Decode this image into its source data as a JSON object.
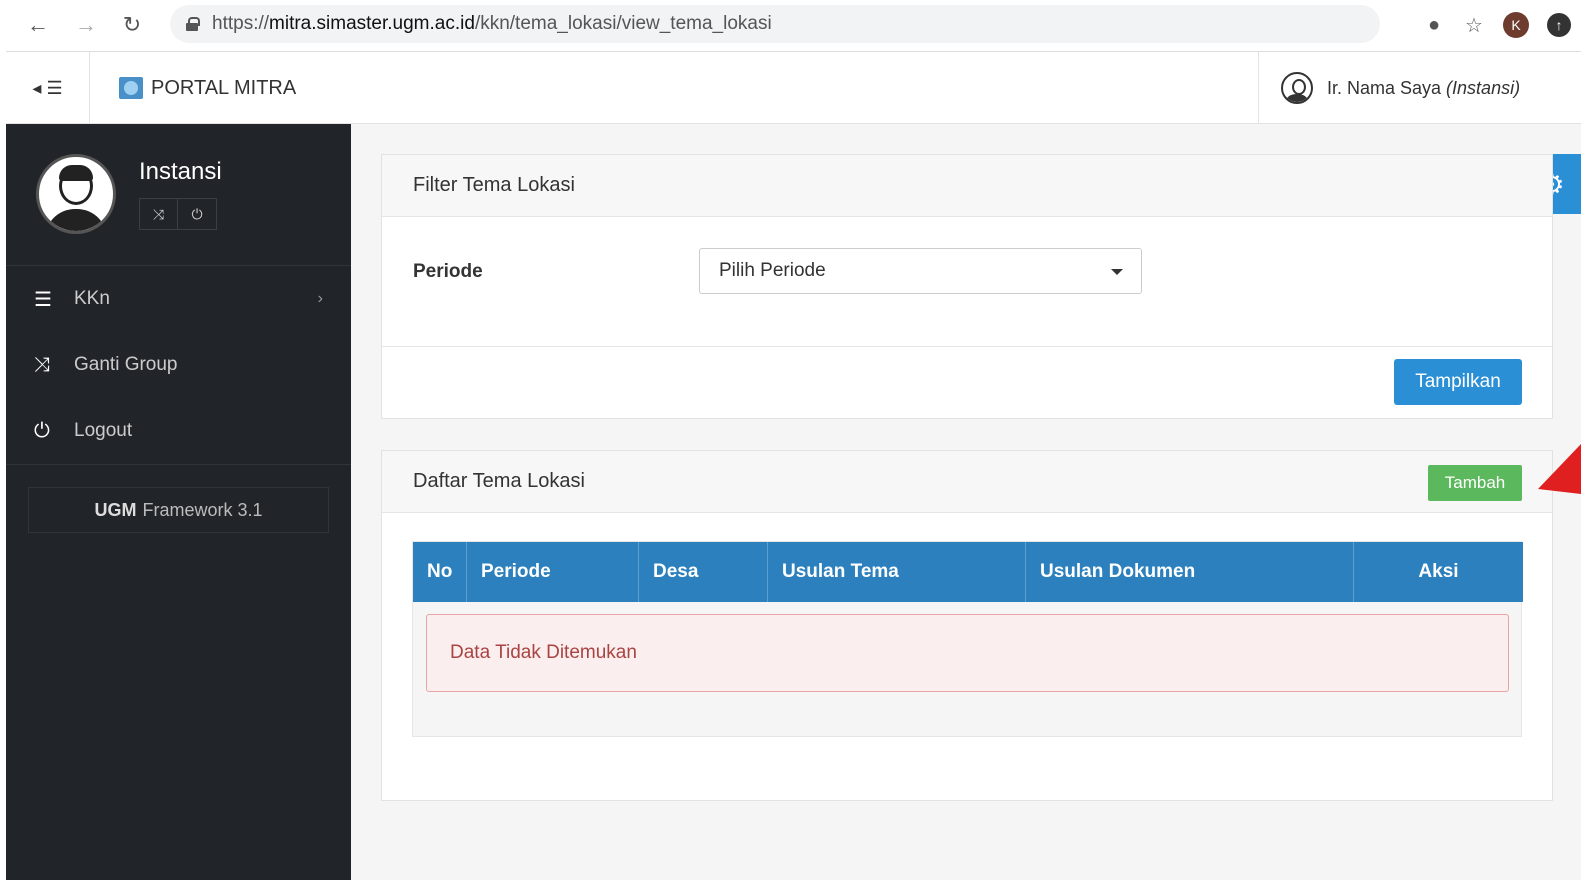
{
  "browser": {
    "url_proto": "https://",
    "url_host": "mitra.simaster.ugm.ac.id",
    "url_path": "/kkn/tema_lokasi/view_tema_lokasi",
    "profile_initial": "K"
  },
  "header": {
    "brand": "PORTAL MITRA",
    "user_name": "Ir. Nama Saya",
    "user_role": "(Instansi)"
  },
  "sidebar": {
    "profile_name": "Instansi",
    "items": [
      {
        "label": "KKn",
        "icon": "list-icon"
      },
      {
        "label": "Ganti Group",
        "icon": "shuffle-icon"
      },
      {
        "label": "Logout",
        "icon": "power-icon"
      }
    ],
    "framework_bold": "UGM",
    "framework_text": "Framework 3.1"
  },
  "filter_panel": {
    "title": "Filter Tema Lokasi",
    "periode_label": "Periode",
    "periode_value": "Pilih Periode",
    "submit_label": "Tampilkan"
  },
  "list_panel": {
    "title": "Daftar Tema Lokasi",
    "add_label": "Tambah",
    "columns": [
      "No",
      "Periode",
      "Desa",
      "Usulan Tema",
      "Usulan Dokumen",
      "Aksi"
    ],
    "empty_message": "Data Tidak Ditemukan"
  },
  "colors": {
    "primary": "#2b8fd6",
    "table_header": "#2b80bd",
    "success": "#5cb85c",
    "sidebar_bg": "#212529",
    "danger_text": "#a94442",
    "annotation_arrow": "#e02020"
  }
}
